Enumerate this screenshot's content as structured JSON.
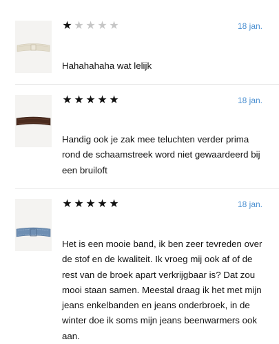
{
  "reviews": [
    {
      "rating": 1,
      "max_rating": 5,
      "date": "18 jan.",
      "text": "Hahahahaha wat lelijk",
      "product_image": "beige-belt"
    },
    {
      "rating": 5,
      "max_rating": 5,
      "date": "18 jan.",
      "text": "Handig ook je zak mee teluchten verder prima rond de schaamstreek word niet gewaardeerd bij een bruiloft",
      "product_image": "brown-belt"
    },
    {
      "rating": 5,
      "max_rating": 5,
      "date": "18 jan.",
      "text": "Het is een mooie band, ik ben zeer tevreden over de stof en de kwaliteit. Ik vroeg mij ook af of de rest van de broek apart verkrijgbaar is? Dat zou mooi staan samen. Meestal draag ik het met mijn jeans enkelbanden en jeans onderbroek, in de winter doe ik soms mijn jeans beenwarmers ook aan.",
      "product_image": "denim-belt"
    }
  ],
  "colors": {
    "date": "#4a8fd1",
    "star_on": "#111111",
    "star_off": "#c6c6c6",
    "divider": "#e6e6e6"
  }
}
